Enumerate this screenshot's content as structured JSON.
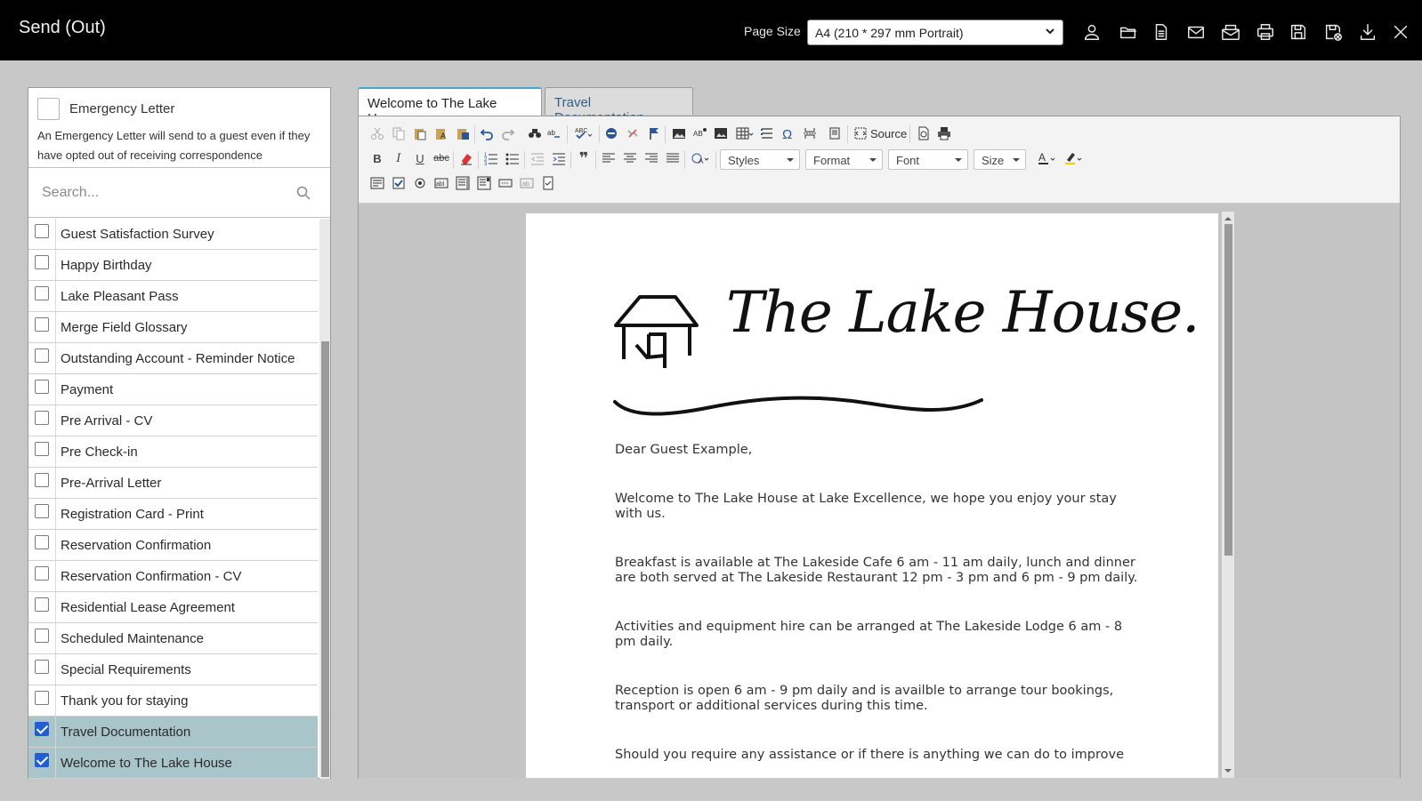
{
  "window": {
    "title": "Send (Out)"
  },
  "page_size": {
    "label": "Page Size",
    "value": "A4 (210 * 297 mm Portrait)"
  },
  "toolbar_icons": [
    "user-icon",
    "folder-open-icon",
    "document-icon",
    "email-icon",
    "email-multiple-icon",
    "print-icon",
    "save-icon",
    "save-close-icon",
    "download-icon",
    "close-icon"
  ],
  "emergency": {
    "label": "Emergency Letter",
    "description": "An Emergency Letter will send to a guest even if they have opted out of receiving correspondence",
    "checked": false
  },
  "search": {
    "placeholder": "Search..."
  },
  "templates": [
    {
      "label": "Guest Satisfaction Survey",
      "checked": false
    },
    {
      "label": "Happy Birthday",
      "checked": false
    },
    {
      "label": "Lake Pleasant Pass",
      "checked": false
    },
    {
      "label": "Merge Field Glossary",
      "checked": false
    },
    {
      "label": "Outstanding Account - Reminder Notice",
      "checked": false
    },
    {
      "label": "Payment",
      "checked": false
    },
    {
      "label": "Pre Arrival - CV",
      "checked": false
    },
    {
      "label": "Pre Check-in",
      "checked": false
    },
    {
      "label": "Pre-Arrival Letter",
      "checked": false
    },
    {
      "label": "Registration Card - Print",
      "checked": false
    },
    {
      "label": "Reservation Confirmation",
      "checked": false
    },
    {
      "label": "Reservation Confirmation - CV",
      "checked": false
    },
    {
      "label": "Residential Lease Agreement",
      "checked": false
    },
    {
      "label": "Scheduled Maintenance",
      "checked": false
    },
    {
      "label": "Special Requirements",
      "checked": false
    },
    {
      "label": "Thank you for staying",
      "checked": false
    },
    {
      "label": "Travel Documentation",
      "checked": true
    },
    {
      "label": "Welcome to The Lake House",
      "checked": true
    }
  ],
  "tabs": [
    {
      "label": "Welcome to The Lake House",
      "active": true
    },
    {
      "label": "Travel Documentation",
      "active": false
    }
  ],
  "editor": {
    "source_label": "Source",
    "styles_label": "Styles",
    "format_label": "Format",
    "font_label": "Font",
    "size_label": "Size"
  },
  "document": {
    "logo_text": "The Lake House.",
    "salutation": "Dear Guest Example,",
    "paragraphs": [
      "Welcome to The Lake House at Lake Excellence, we hope you enjoy your stay with us.",
      "Breakfast is available at The Lakeside Cafe 6 am - 11 am daily, lunch and dinner are both served at The Lakeside Restaurant 12 pm - 3 pm and 6 pm - 9 pm daily.",
      "Activities and equipment hire can be arranged at The Lakeside Lodge 6 am - 8 pm daily.",
      "Reception is open 6 am - 9 pm daily and is availble to arrange tour bookings, transport or additional services during this time.",
      "Should you require any assistance or if there is anything we can do to improve"
    ]
  },
  "colors": {
    "topbar": "#000000",
    "selected_row": "#a9c5ca",
    "checkbox_checked": "#1f5fd3",
    "tab_link": "#2f5f8a"
  }
}
